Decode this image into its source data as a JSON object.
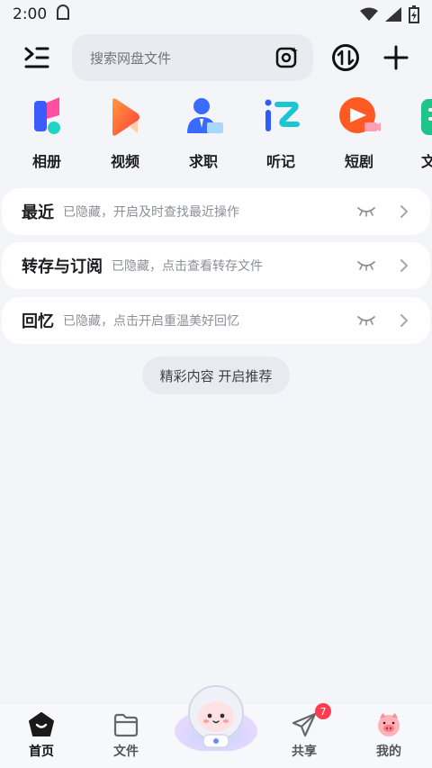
{
  "status_bar": {
    "time": "2:00"
  },
  "search": {
    "placeholder": "搜索网盘文件"
  },
  "apps": [
    {
      "label": "相册",
      "icon": "photo-album-icon"
    },
    {
      "label": "视频",
      "icon": "video-play-icon"
    },
    {
      "label": "求职",
      "icon": "job-person-icon"
    },
    {
      "label": "听记",
      "icon": "listen-notes-icon"
    },
    {
      "label": "短剧",
      "icon": "short-drama-icon"
    },
    {
      "label": "文",
      "icon": "document-icon"
    }
  ],
  "cards": [
    {
      "title": "最近",
      "desc": "已隐藏，开启及时查找最近操作"
    },
    {
      "title": "转存与订阅",
      "desc": "已隐藏，点击查看转存文件"
    },
    {
      "title": "回忆",
      "desc": "已隐藏，点击开启重温美好回忆"
    }
  ],
  "recommend": {
    "label": "精彩内容 开启推荐"
  },
  "nav": {
    "home": "首页",
    "files": "文件",
    "share": "共享",
    "mine": "我的",
    "share_badge": "7"
  },
  "colors": {
    "background": "#f4f5f9",
    "card": "#ffffff",
    "badge": "#ff3b50"
  }
}
